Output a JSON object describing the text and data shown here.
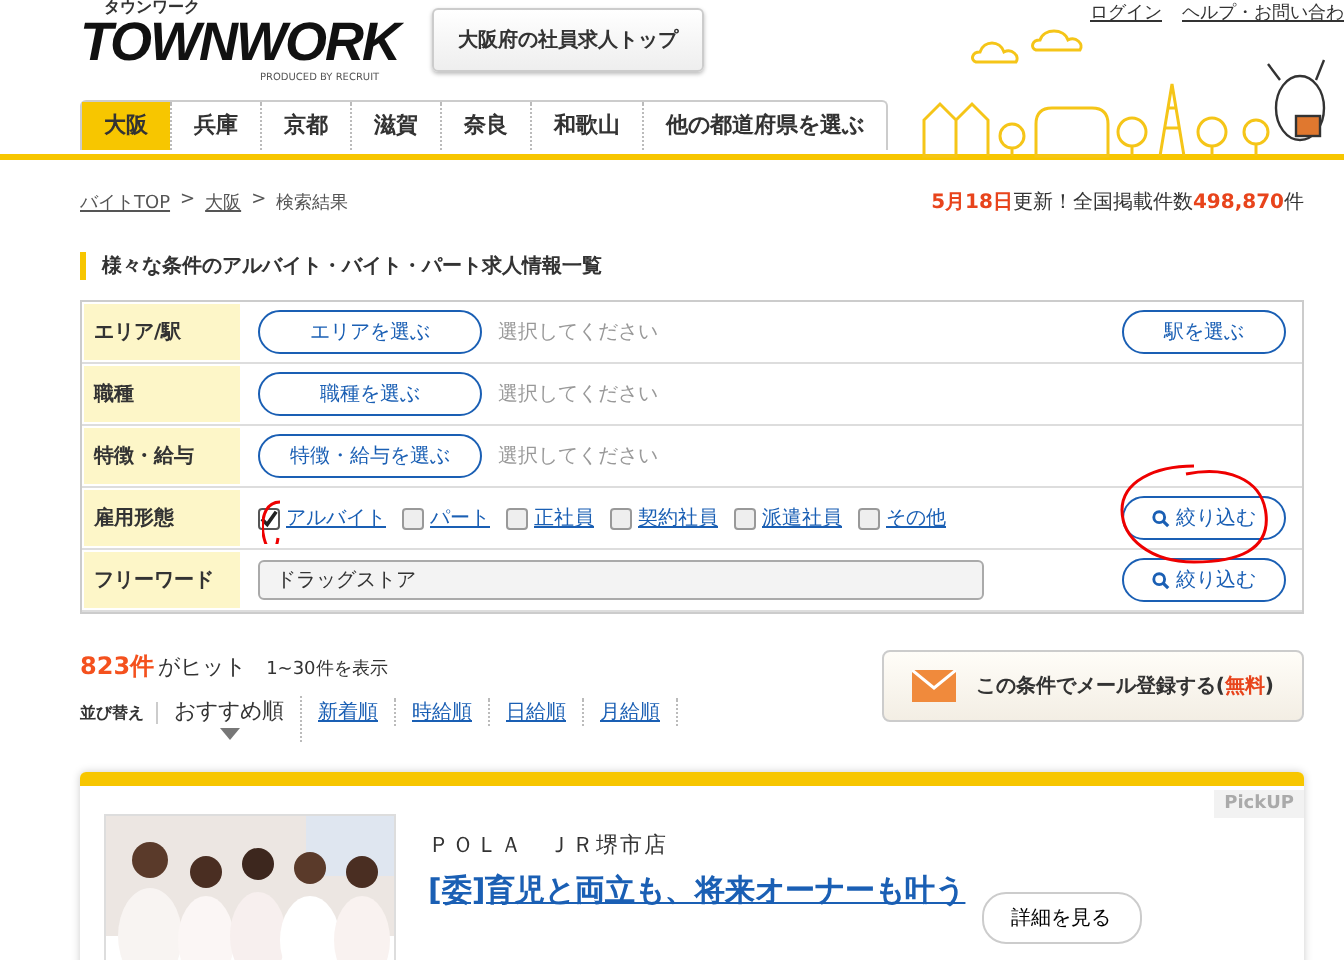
{
  "header": {
    "logo_kana": "タウンワーク",
    "logo": "TOWNWORK",
    "logo_sub": "PRODUCED BY RECRUIT",
    "top_button": "大阪府の社員求人トップ",
    "links": [
      "ログイン",
      "ヘルプ・お問い合わ"
    ]
  },
  "prefecture_tabs": [
    {
      "label": "大阪",
      "selected": true
    },
    {
      "label": "兵庫",
      "selected": false
    },
    {
      "label": "京都",
      "selected": false
    },
    {
      "label": "滋賀",
      "selected": false
    },
    {
      "label": "奈良",
      "selected": false
    },
    {
      "label": "和歌山",
      "selected": false
    },
    {
      "label": "他の都道府県を選ぶ",
      "selected": false
    }
  ],
  "breadcrumb": [
    {
      "label": "バイトTOP",
      "link": true
    },
    {
      "separator": ">",
      "label": "大阪",
      "link": true
    },
    {
      "separator": ">",
      "label": "検索結果",
      "link": false
    }
  ],
  "update_notice": {
    "date": "5月18日",
    "text1": "更新！全国掲載件数",
    "count": "498,870",
    "unit": "件"
  },
  "heading": "様々な条件のアルバイト・バイト・パート求人情報一覧",
  "search_form": {
    "rows": [
      {
        "kind": "select",
        "label": "エリア/駅",
        "button": "エリアを選ぶ",
        "placeholder": "選択してください",
        "side_button": "駅を選ぶ"
      },
      {
        "kind": "select",
        "label": "職種",
        "button": "職種を選ぶ",
        "placeholder": "選択してください"
      },
      {
        "kind": "select",
        "label": "特徴・給与",
        "button": "特徴・給与を選ぶ",
        "placeholder": "選択してください"
      },
      {
        "kind": "checks",
        "label": "雇用形態",
        "options": [
          {
            "label": "アルバイト",
            "checked": true
          },
          {
            "label": "パート",
            "checked": false
          },
          {
            "label": "正社員",
            "checked": false
          },
          {
            "label": "契約社員",
            "checked": false
          },
          {
            "label": "派遣社員",
            "checked": false
          },
          {
            "label": "その他",
            "checked": false
          }
        ],
        "side_button": "絞り込む"
      },
      {
        "kind": "text",
        "label": "フリーワード",
        "value": "ドラッグストア",
        "side_button": "絞り込む"
      }
    ]
  },
  "results": {
    "count": "823件",
    "count_suffix": "がヒット",
    "range": "1~30件を表示",
    "sort_label": "並び替え",
    "sort_options": [
      {
        "label": "おすすめ順",
        "selected": true
      },
      {
        "label": "新着順",
        "selected": false
      },
      {
        "label": "時給順",
        "selected": false
      },
      {
        "label": "日給順",
        "selected": false
      },
      {
        "label": "月給順",
        "selected": false
      }
    ],
    "mail_button": "この条件でメール登録する(",
    "mail_free": "無料",
    "mail_close": ")"
  },
  "job_card": {
    "badge": "PickUP",
    "company": "ＰＯＬＡ　ＪＲ堺市店",
    "title": "[委]育児と両立も、将来オーナーも叶う",
    "detail_button": "詳細を見る"
  }
}
